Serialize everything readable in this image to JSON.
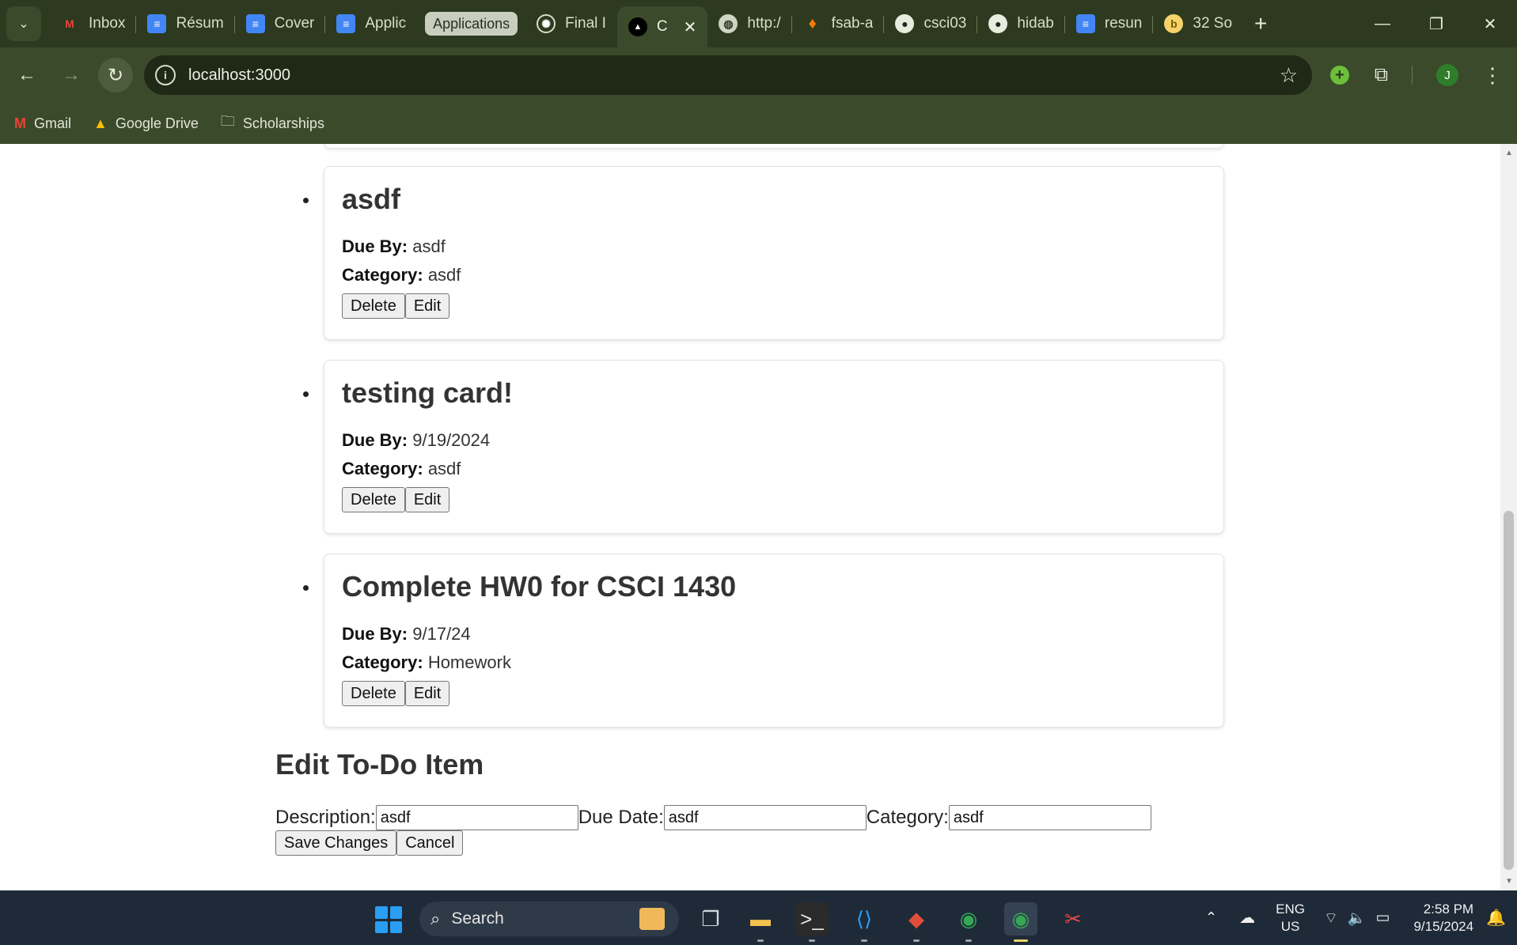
{
  "browser": {
    "tabs": [
      {
        "title": "Inbox",
        "icon": "gmail-icon",
        "color": "#ea4335",
        "glyph": "M"
      },
      {
        "title": "Résum",
        "icon": "docs-icon",
        "color": "#4285f4",
        "glyph": "≡"
      },
      {
        "title": "Cover",
        "icon": "docs-icon",
        "color": "#4285f4",
        "glyph": "≡"
      },
      {
        "title": "Applic",
        "icon": "docs-icon",
        "color": "#4285f4",
        "glyph": "≡"
      },
      {
        "title": "Final I",
        "icon": "openai-icon",
        "color": "#444444",
        "glyph": "✺"
      },
      {
        "title": "C",
        "icon": "vercel-icon",
        "color": "#000000",
        "glyph": "▲"
      },
      {
        "title": "http:/",
        "icon": "globe-icon",
        "color": "#5f6b52",
        "glyph": "◍"
      },
      {
        "title": "fsab-a",
        "icon": "firebase-icon",
        "color": "#f57c00",
        "glyph": "♦"
      },
      {
        "title": "csci03",
        "icon": "github-icon",
        "color": "#222222",
        "glyph": "●"
      },
      {
        "title": "hidab",
        "icon": "github-icon",
        "color": "#222222",
        "glyph": "●"
      },
      {
        "title": "resun",
        "icon": "docs-icon",
        "color": "#4285f4",
        "glyph": "≡"
      },
      {
        "title": "32 So",
        "icon": "bitcoin-icon",
        "color": "#f5d36a",
        "glyph": "b"
      }
    ],
    "group_label": "Applications",
    "new_tab": "+",
    "url": "localhost:3000",
    "profile_initial": "J",
    "bookmarks": [
      {
        "label": "Gmail",
        "icon": "gmail-icon"
      },
      {
        "label": "Google Drive",
        "icon": "drive-icon"
      },
      {
        "label": "Scholarships",
        "icon": "folder-icon"
      }
    ]
  },
  "todos": [
    {
      "title": "asdf",
      "due_label": "Due By:",
      "due": "asdf",
      "category_label": "Category:",
      "category": "asdf",
      "delete_label": "Delete",
      "edit_label": "Edit"
    },
    {
      "title": "testing card!",
      "due_label": "Due By:",
      "due": "9/19/2024",
      "category_label": "Category:",
      "category": "asdf",
      "delete_label": "Delete",
      "edit_label": "Edit"
    },
    {
      "title": "Complete HW0 for CSCI 1430",
      "due_label": "Due By:",
      "due": "9/17/24",
      "category_label": "Category:",
      "category": "Homework",
      "delete_label": "Delete",
      "edit_label": "Edit"
    }
  ],
  "edit_form": {
    "heading": "Edit To-Do Item",
    "description_label": "Description:",
    "description_value": "asdf",
    "due_label": "Due Date:",
    "due_value": "asdf",
    "category_label": "Category:",
    "category_value": "asdf",
    "save_label": "Save Changes",
    "cancel_label": "Cancel"
  },
  "taskbar": {
    "search_placeholder": "Search",
    "lang_line1": "ENG",
    "lang_line2": "US",
    "time": "2:58 PM",
    "date": "9/15/2024",
    "apps": [
      "task-view-icon",
      "file-explorer-icon",
      "terminal-icon",
      "vscode-icon",
      "git-icon",
      "chrome-icon",
      "chrome-icon",
      "snipping-tool-icon"
    ]
  }
}
